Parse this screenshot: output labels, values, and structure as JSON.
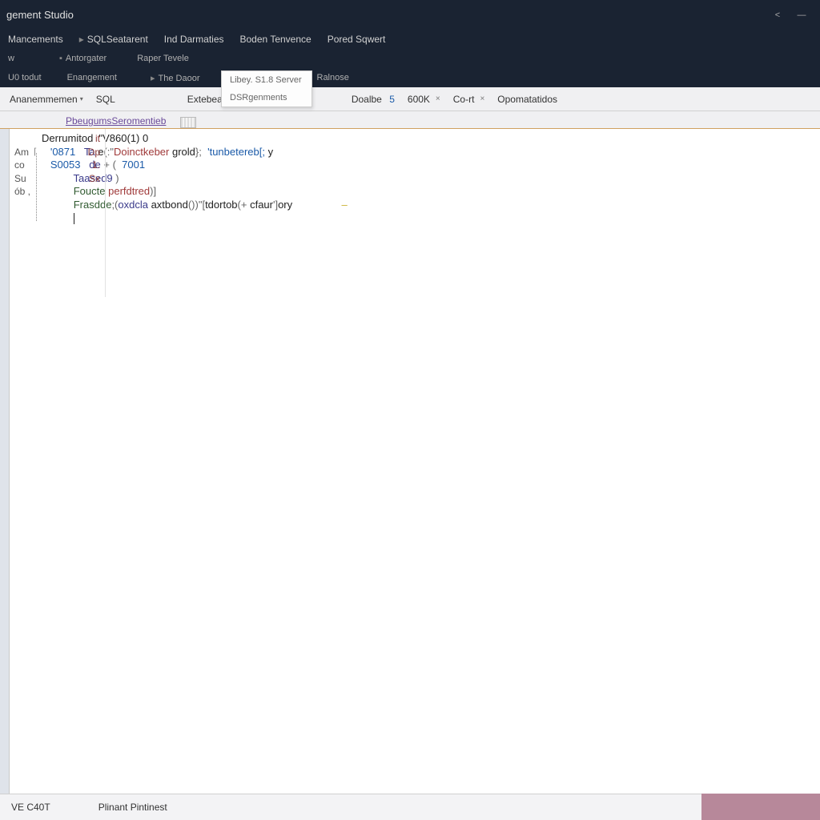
{
  "title": "gement Studio",
  "winctrl": {
    "back": "<",
    "min": "—"
  },
  "menu": {
    "row1": [
      "Mancements",
      "SQLSeatarent",
      "Ind Darmaties",
      "Boden Tenvence",
      "Pored Sqwert"
    ],
    "row2": [
      "w",
      "Antorgater",
      "Raper Tevele"
    ],
    "row3": [
      "U0 todut",
      "Enangement",
      "The Daoor",
      "",
      "Ralnose"
    ]
  },
  "dropdown": [
    "Libey. S1.8 Server",
    "DSRgenments"
  ],
  "toolbar": {
    "items": [
      "Ananemmemen",
      "SQL",
      "Extebead"
    ],
    "right": [
      {
        "label": "Doalbe",
        "val": "5",
        "x": ""
      },
      {
        "label": "600K",
        "x": "×"
      },
      {
        "label": "Co-rt",
        "x": "×"
      },
      {
        "label": "Opomatatidos",
        "x": ""
      }
    ]
  },
  "tab": "PbeugumsSeromentieb",
  "code": {
    "header": "Derrumitod  \"V860(1) 0",
    "lines": [
      {
        "ln": "'0871",
        "txt": "Ta e(:\"Doinctkeber grold};  'tunbetereb[; y"
      },
      {
        "ln": "S0053",
        "txt": "de + (  7001"
      },
      {
        "ln": "",
        "txt": "Taased9 )"
      },
      {
        "ln": "",
        "txt": "Foucte perfdtred)]"
      },
      {
        "ln": "",
        "txt": "Frasdde;(oxdcla axtbond())\"[tdortob(+ cfaur']ory"
      }
    ]
  },
  "left_rows": [
    {
      "k": "",
      "v": ""
    },
    {
      "k": "",
      "v": ""
    },
    {
      "k": "",
      "v": ""
    },
    {
      "k": "",
      "v": ""
    },
    {
      "k": "",
      "v": ""
    },
    {
      "k": "",
      "v": ""
    },
    {
      "k": "",
      "v": "it"
    },
    {
      "k": "Am",
      "v": "Dp"
    },
    {
      "k": "co",
      "v": "1."
    },
    {
      "k": "Su",
      "v": "Sx"
    },
    {
      "k": "ób ,",
      "v": ""
    }
  ],
  "status": {
    "left": "VE C40T",
    "mid": "Plinant Pintinest"
  }
}
